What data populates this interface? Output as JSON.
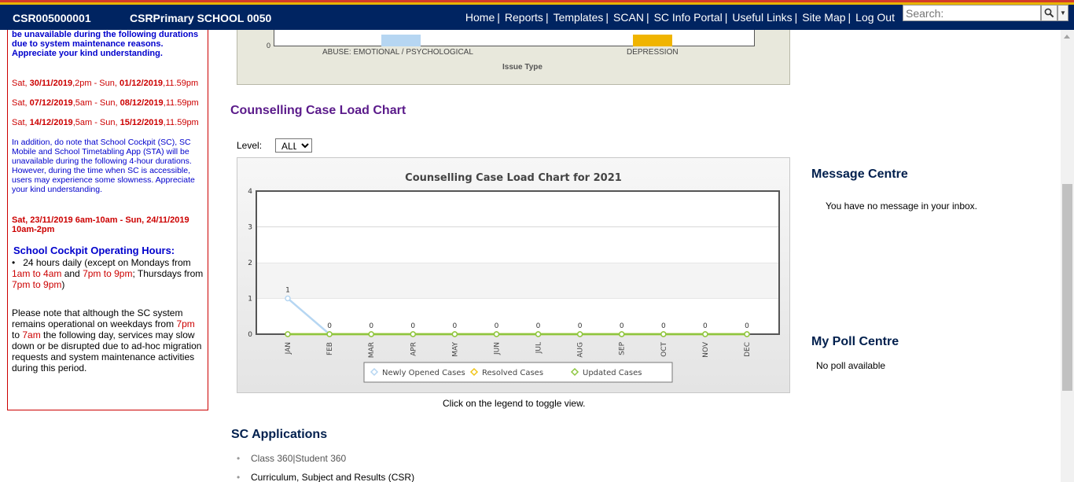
{
  "header": {
    "account_code": "CSR005000001",
    "school_name": "CSRPrimary SCHOOL 0050",
    "nav": [
      "Home",
      "Reports",
      "Templates",
      "SCAN",
      "SC Info Portal",
      "Useful Links",
      "Site Map",
      "Log Out"
    ],
    "search_placeholder": "Search:"
  },
  "notice": {
    "intro": "be unavailable during the following durations due to system maintenance reasons. Appreciate your kind understanding.",
    "maintenance_dates": [
      {
        "start_day": "Sat, ",
        "start_date": "30/11/2019",
        "start_rest": ",2pm - Sun, ",
        "end_date": "01/12/2019",
        "end_rest": ",11.59pm"
      },
      {
        "start_day": "Sat, ",
        "start_date": "07/12/2019",
        "start_rest": ",5am - Sun, ",
        "end_date": "08/12/2019",
        "end_rest": ",11.59pm"
      },
      {
        "start_day": "Sat, ",
        "start_date": "14/12/2019",
        "start_rest": ",5am - Sun, ",
        "end_date": "15/12/2019",
        "end_rest": ",11.59pm"
      }
    ],
    "addition": "In addition, do note that School Cockpit (SC), SC Mobile and School Timetabling App (STA) will be unavailable during the following 4-hour durations. However, during the time when SC is accessible, users may experience some slowness. Appreciate your kind understanding.",
    "outage": "Sat, 23/11/2019 6am-10am - Sun, 24/11/2019 10am-2pm",
    "hours_title": "School Cockpit Operating Hours:",
    "hours_parts": [
      "24 hours daily (except on Mondays from ",
      "1am to 4am",
      " and ",
      "7pm to 9pm",
      "; Thursdays from ",
      "7pm to 9pm",
      ")"
    ],
    "ops_parts": [
      "Please note that although the SC system remains operational on weekdays from ",
      "7pm",
      " to ",
      "7am",
      " the following day, services may slow down or be disrupted due to ad-hoc migration requests and system maintenance activities during this period."
    ]
  },
  "issue_chart": {
    "zero_tick": "0",
    "categories": [
      "ABUSE: EMOTIONAL / PSYCHOLOGICAL",
      "DEPRESSION"
    ],
    "xlabel": "Issue Type",
    "colors": [
      "#b6d6f2",
      "#f0b400"
    ]
  },
  "main": {
    "section_title": "Counselling Case Load Chart",
    "level_label": "Level:",
    "level_value": "ALL",
    "toggle_hint": "Click on the legend to toggle view.",
    "apps_title": "SC Applications",
    "apps": [
      {
        "parts": [
          "Class 360",
          " | ",
          "Student 360"
        ]
      },
      {
        "parts": [
          "Curriculum, Subject and Results (CSR)"
        ]
      }
    ]
  },
  "chart_data": {
    "type": "line",
    "title": "Counselling Case Load Chart for 2021",
    "categories": [
      "JAN",
      "FEB",
      "MAR",
      "APR",
      "MAY",
      "JUN",
      "JUL",
      "AUG",
      "SEP",
      "OCT",
      "NOV",
      "DEC"
    ],
    "series": [
      {
        "name": "Newly Opened Cases",
        "values": [
          1,
          0,
          0,
          0,
          0,
          0,
          0,
          0,
          0,
          0,
          0,
          0
        ],
        "color": "#b6d6f2"
      },
      {
        "name": "Resolved Cases",
        "values": [
          0,
          0,
          0,
          0,
          0,
          0,
          0,
          0,
          0,
          0,
          0,
          0
        ],
        "color": "#f0c419"
      },
      {
        "name": "Updated Cases",
        "values": [
          0,
          0,
          0,
          0,
          0,
          0,
          0,
          0,
          0,
          0,
          0,
          0
        ],
        "color": "#8dc63f"
      }
    ],
    "data_labels": [
      1,
      0,
      0,
      0,
      0,
      0,
      0,
      0,
      0,
      0,
      0,
      0
    ],
    "ylim": [
      0,
      4
    ],
    "yticks": [
      0,
      1,
      2,
      3,
      4
    ],
    "grid": true,
    "legend_position": "bottom-center"
  },
  "sidebar_right": {
    "message_title": "Message Centre",
    "message_text": "You have no message in your inbox.",
    "poll_title": "My Poll Centre",
    "poll_text": "No poll available"
  }
}
